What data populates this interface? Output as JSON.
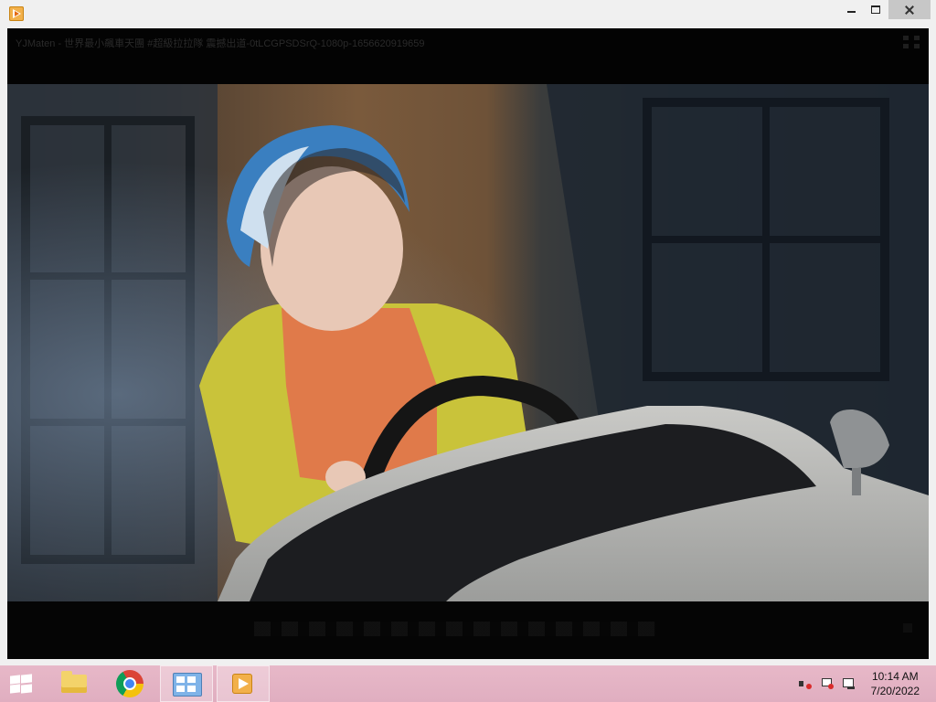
{
  "window": {
    "title": "",
    "controls": {
      "minimize": "minimize",
      "maximize": "maximize",
      "close": "close"
    }
  },
  "player": {
    "video_title": "YJMaten - 世界最小飆車天團 #超級拉拉隊 震撼出道-0tLCGPSDSrQ-1080p-1656620919659",
    "fullscreen_icon": "fullscreen-icon"
  },
  "taskbar": {
    "items": [
      {
        "name": "file-explorer",
        "icon": "folder-icon",
        "active": false
      },
      {
        "name": "chrome",
        "icon": "chrome-icon",
        "active": false
      },
      {
        "name": "control-panel",
        "icon": "control-panel-icon",
        "active": true
      },
      {
        "name": "video-player",
        "icon": "player-icon",
        "active": true
      }
    ],
    "tray": {
      "icons": [
        "speaker-muted-icon",
        "action-center-flag-icon",
        "network-icon"
      ]
    },
    "clock": {
      "time": "10:14 AM",
      "date": "7/20/2022"
    }
  },
  "colors": {
    "taskbar": "#e2b0c2",
    "player_bg": "#000000",
    "close_hover": "#c7c7c7"
  }
}
